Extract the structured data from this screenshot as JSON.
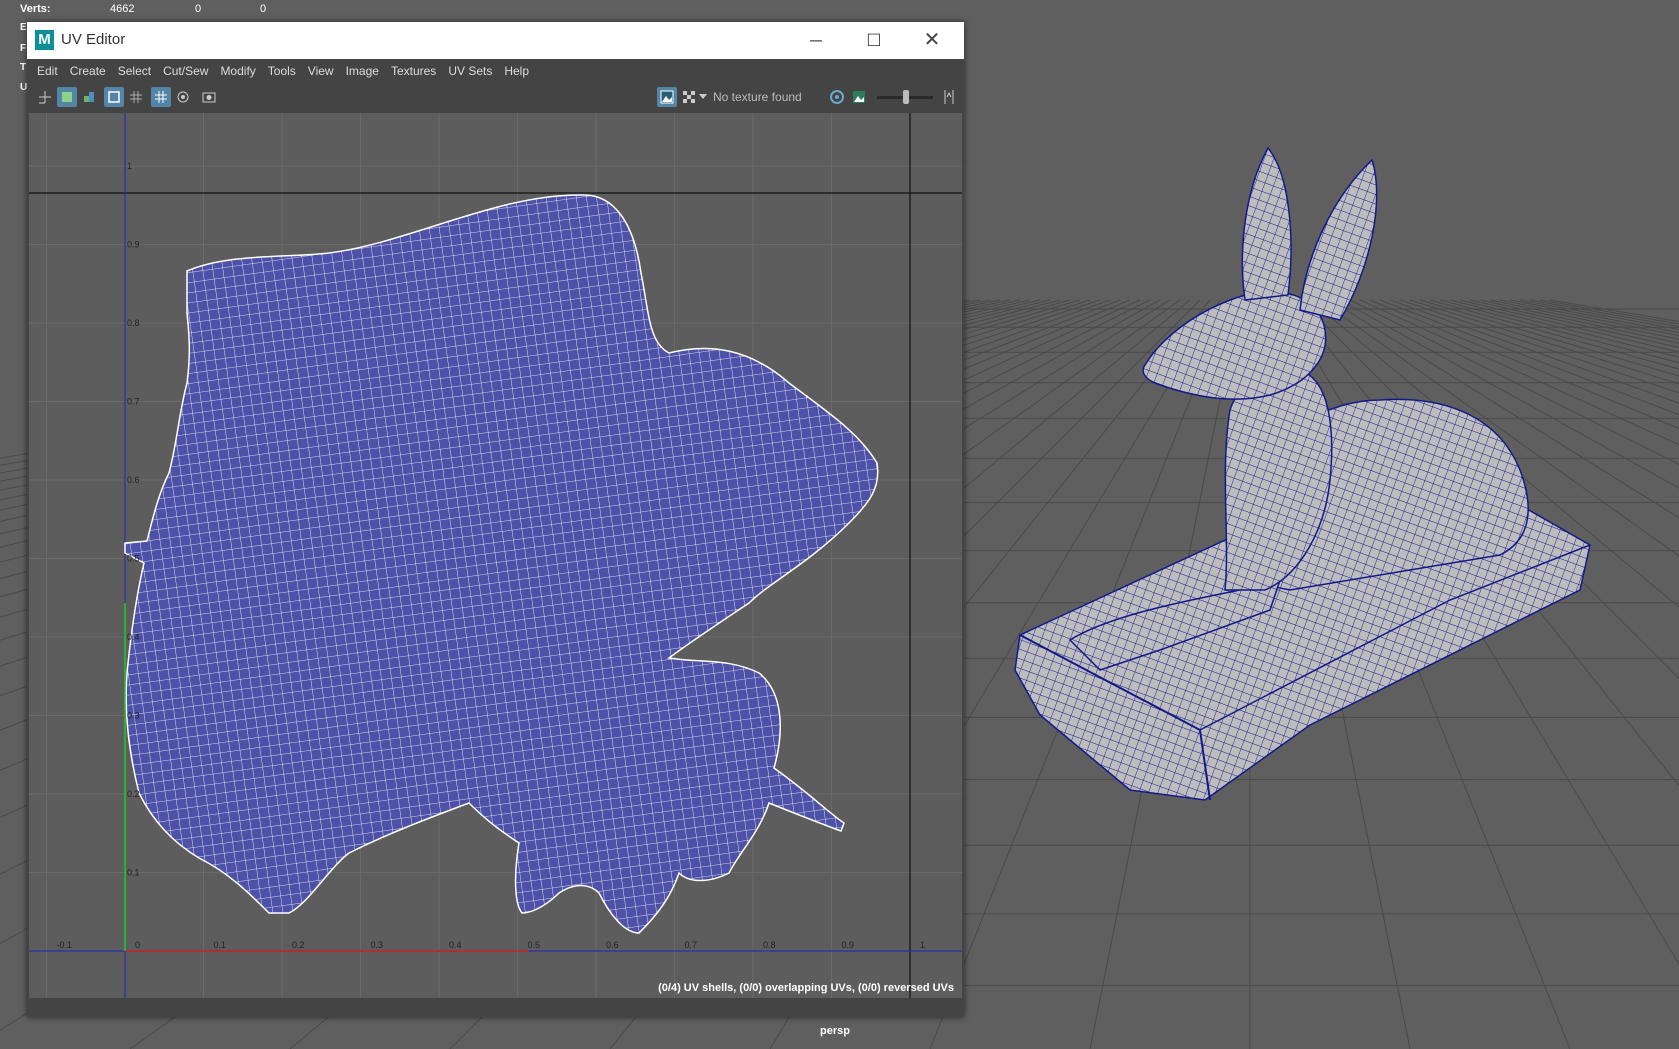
{
  "hud": {
    "verts_label": "Verts:",
    "verts_value": "4662",
    "verts_sel": "0",
    "verts_extra": "0",
    "side_letters": [
      "E",
      "F",
      "T",
      "U"
    ]
  },
  "viewport": {
    "camera_label": "persp"
  },
  "uv_editor": {
    "title": "UV Editor",
    "app_icon": "M",
    "window_controls": {
      "minimize": "─",
      "maximize": "☐",
      "close": "✕"
    },
    "menus": [
      "Edit",
      "Create",
      "Select",
      "Cut/Sew",
      "Modify",
      "Tools",
      "View",
      "Image",
      "Textures",
      "UV Sets",
      "Help"
    ],
    "toolbar": {
      "texture_status": "No texture found",
      "icons": [
        "uv-layout-icon",
        "shaded-uv-icon",
        "distortion-icon",
        "texture-borders-icon",
        "checker-icon",
        "grid-icon",
        "pixel-snap-icon",
        "snapshot-icon",
        "display-image-icon",
        "checker-map-icon",
        "dropdown-icon",
        "uv-toolkit-icon",
        "image-ratio-icon",
        "exposure-slider-icon",
        "isolate-icon"
      ]
    },
    "axis_ticks_u": [
      "-0.1",
      "0",
      "0.1",
      "0.2",
      "0.3",
      "0.4",
      "0.5",
      "0.6",
      "0.7",
      "0.8",
      "0.9",
      "1"
    ],
    "axis_ticks_v": [
      "0.1",
      "0.2",
      "0.3",
      "0.4",
      "0.5",
      "0.6",
      "0.7",
      "0.8",
      "0.9",
      "1"
    ],
    "status": "(0/4) UV shells, (0/0) overlapping UVs, (0/0) reversed UVs",
    "colors": {
      "uv_shell_fill": "#4d51a7",
      "wire": "#ffffff",
      "u_axis": "#cc2222",
      "v_axis": "#22cc22",
      "mesh_wire": "#141a8c"
    }
  }
}
